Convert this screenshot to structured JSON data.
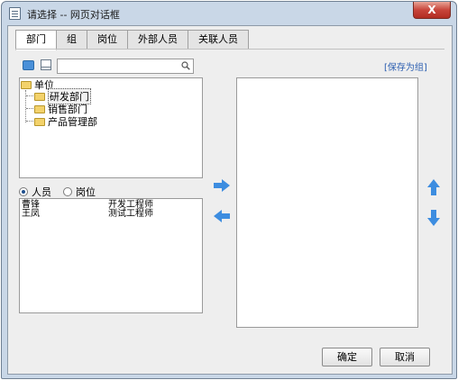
{
  "window": {
    "title": "请选择 -- 网页对话框",
    "close_label": "X"
  },
  "tabs": [
    "部门",
    "组",
    "岗位",
    "外部人员",
    "关联人员"
  ],
  "search": {
    "placeholder": ""
  },
  "links": {
    "save_group": "[保存为组]"
  },
  "tree": {
    "root": "单位",
    "children": [
      "研发部门",
      "销售部门",
      "产品管理部"
    ]
  },
  "filter": {
    "person_label": "人员",
    "position_label": "岗位",
    "selected": "人员"
  },
  "people": [
    {
      "name": "曹锋",
      "role": "开发工程师"
    },
    {
      "name": "王凤",
      "role": "测试工程师"
    }
  ],
  "buttons": {
    "ok": "确定",
    "cancel": "取消"
  },
  "colors": {
    "arrow": "#3d8de0",
    "link": "#2a5db0",
    "close": "#c8453b"
  },
  "icons": [
    "document-icon",
    "close-icon",
    "user-add-icon",
    "card-icon",
    "search-icon",
    "folder-icon",
    "arrow-right-icon",
    "arrow-left-icon",
    "arrow-up-icon",
    "arrow-down-icon"
  ]
}
